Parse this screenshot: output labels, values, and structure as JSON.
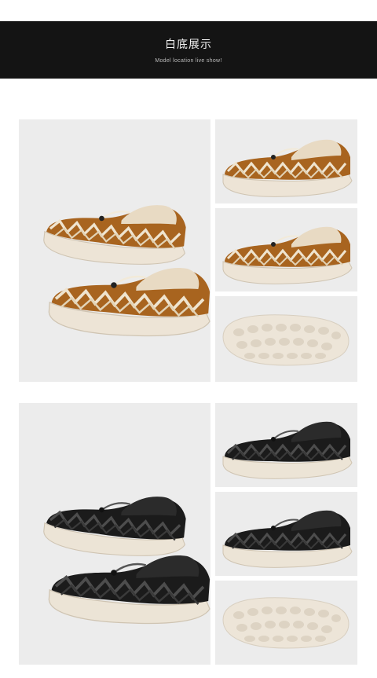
{
  "header": {
    "title": "白底展示",
    "subtitle": "Model location live show!"
  },
  "groups": [
    {
      "colorway": "brown",
      "colors": {
        "upper": "#a8641f",
        "rope": "#e9dcc2",
        "sole": "#ede4d6",
        "mesh": "#e8dac3"
      },
      "panels": [
        "main-pair-photo",
        "side-view-photo",
        "side-view-photo",
        "outsole-photo"
      ]
    },
    {
      "colorway": "black",
      "colors": {
        "upper": "#1b1b1b",
        "rope": "#4a4a4a",
        "sole": "#ece4d6",
        "mesh": "#2a2a2a"
      },
      "panels": [
        "main-pair-photo",
        "side-view-photo",
        "side-view-photo",
        "outsole-photo"
      ]
    }
  ]
}
